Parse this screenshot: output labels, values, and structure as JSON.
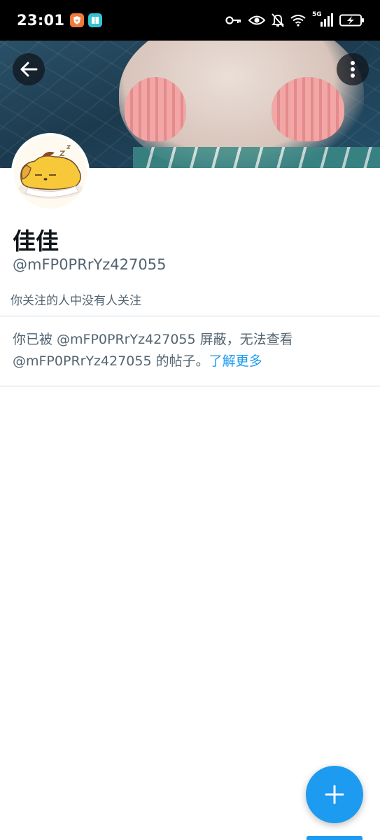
{
  "status_bar": {
    "time": "23:01",
    "network_label": "5G",
    "app_icons": [
      "brave-app-icon",
      "reader-app-icon"
    ],
    "system_icons": [
      "vpn-key-icon",
      "eye-icon",
      "bell-off-icon",
      "wifi-icon",
      "signal-icon",
      "battery-charging-icon"
    ]
  },
  "banner": {
    "back_icon": "arrow-left-icon",
    "more_icon": "more-vertical-icon"
  },
  "profile": {
    "display_name": "佳佳",
    "handle": "@mFP0PRrYz427055",
    "followers_you_know": "你关注的人中没有人关注"
  },
  "blocked_notice": {
    "text": "你已被 @mFP0PRrYz427055 屏蔽，无法查看 @mFP0PRrYz427055 的帖子。",
    "link_label": "了解更多"
  },
  "fab": {
    "icon": "plus-icon"
  },
  "colors": {
    "accent": "#1d9bf0",
    "secondary_text": "#536471",
    "primary_text": "#0f1419",
    "divider": "#cfd9de"
  }
}
